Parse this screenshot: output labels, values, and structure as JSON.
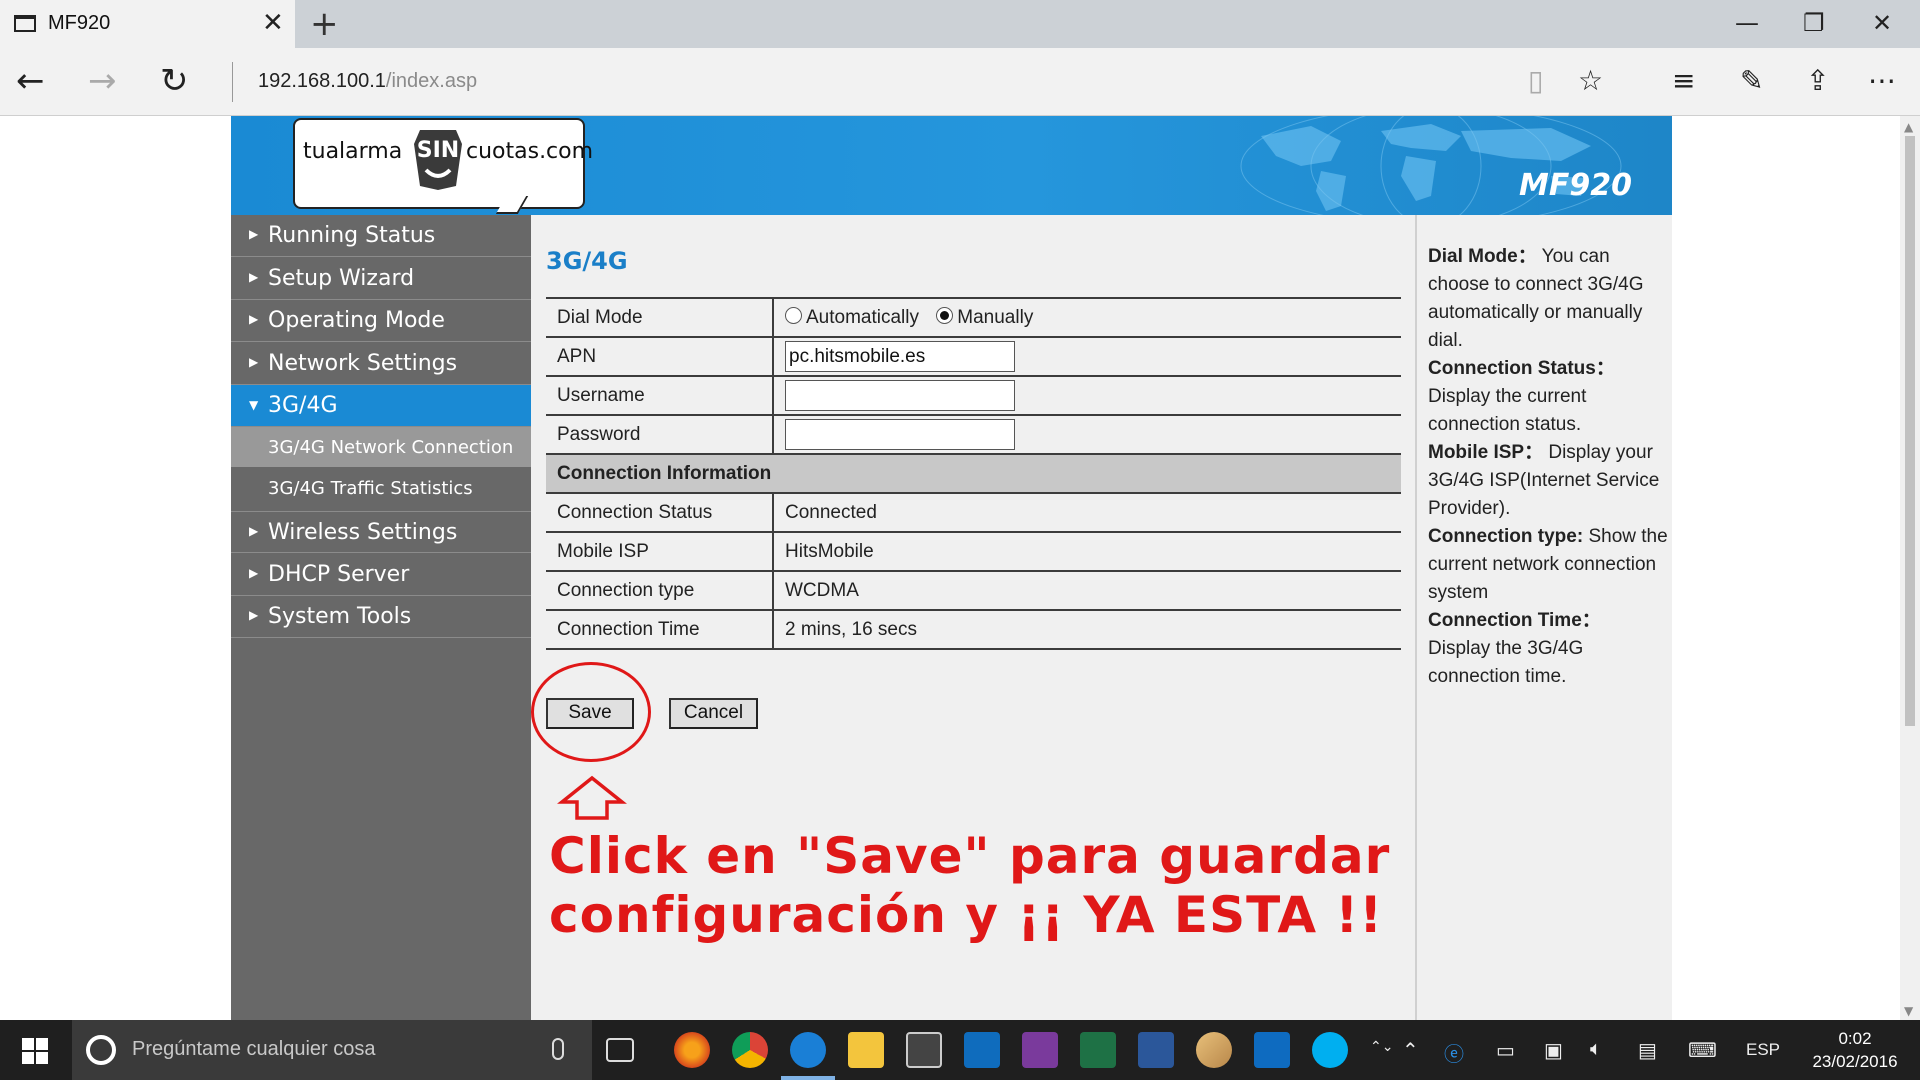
{
  "browser": {
    "tab_title": "MF920",
    "new_tab": "+",
    "url_host": "192.168.100.1",
    "url_path": "/index.asp",
    "icons": [
      "back-icon",
      "forward-icon",
      "refresh-icon",
      "reading-view-icon",
      "favorite-icon",
      "hub-icon",
      "web-note-icon",
      "share-icon",
      "more-icon"
    ]
  },
  "banner": {
    "logo_left": "tualarma",
    "logo_badge": "SIN",
    "logo_right": "cuotas.com",
    "model": "MF920"
  },
  "sidebar": {
    "items": [
      {
        "label": "Running Status"
      },
      {
        "label": "Setup Wizard"
      },
      {
        "label": "Operating Mode"
      },
      {
        "label": "Network Settings"
      },
      {
        "label": "3G/4G"
      },
      {
        "label": "Wireless Settings"
      },
      {
        "label": "DHCP Server"
      },
      {
        "label": "System Tools"
      }
    ],
    "subitems": [
      {
        "label": "3G/4G Network Connection"
      },
      {
        "label": "3G/4G Traffic Statistics"
      }
    ]
  },
  "main": {
    "heading": "3G/4G",
    "dial_mode_label": "Dial Mode",
    "dial_auto": "Automatically",
    "dial_manual": "Manually",
    "apn_label": "APN",
    "apn_value": "pc.hitsmobile.es",
    "username_label": "Username",
    "username_value": "",
    "password_label": "Password",
    "password_value": "",
    "section_title": "Connection Information",
    "info": [
      {
        "label": "Connection Status",
        "value": "Connected"
      },
      {
        "label": "Mobile ISP",
        "value": "HitsMobile"
      },
      {
        "label": "Connection type",
        "value": "WCDMA"
      },
      {
        "label": "Connection Time",
        "value": "2 mins, 16 secs"
      }
    ],
    "save_label": "Save",
    "cancel_label": "Cancel",
    "annotation_line1": "Click en \"Save\" para guardar",
    "annotation_line2": "configuración y ¡¡ YA ESTA !!"
  },
  "help": [
    {
      "term": "Dial Mode：",
      "text": " You can choose to connect 3G/4G automatically or manually dial."
    },
    {
      "term": "Connection Status：",
      "text": " Display the current connection status."
    },
    {
      "term": "Mobile ISP：",
      "text": " Display your 3G/4G ISP(Internet Service Provider)."
    },
    {
      "term": "Connection type:",
      "text": " Show the current network connection system"
    },
    {
      "term": "Connection Time：",
      "text": " Display the 3G/4G connection time."
    }
  ],
  "taskbar": {
    "search_placeholder": "Pregúntame cualquier cosa",
    "language": "ESP",
    "time": "0:02",
    "date": "23/02/2016"
  },
  "colors": {
    "banner_blue": "#1a8ad4",
    "sidebar_gray": "#686868",
    "heading_blue": "#1a7fc8",
    "annotation_red": "#e01818"
  }
}
